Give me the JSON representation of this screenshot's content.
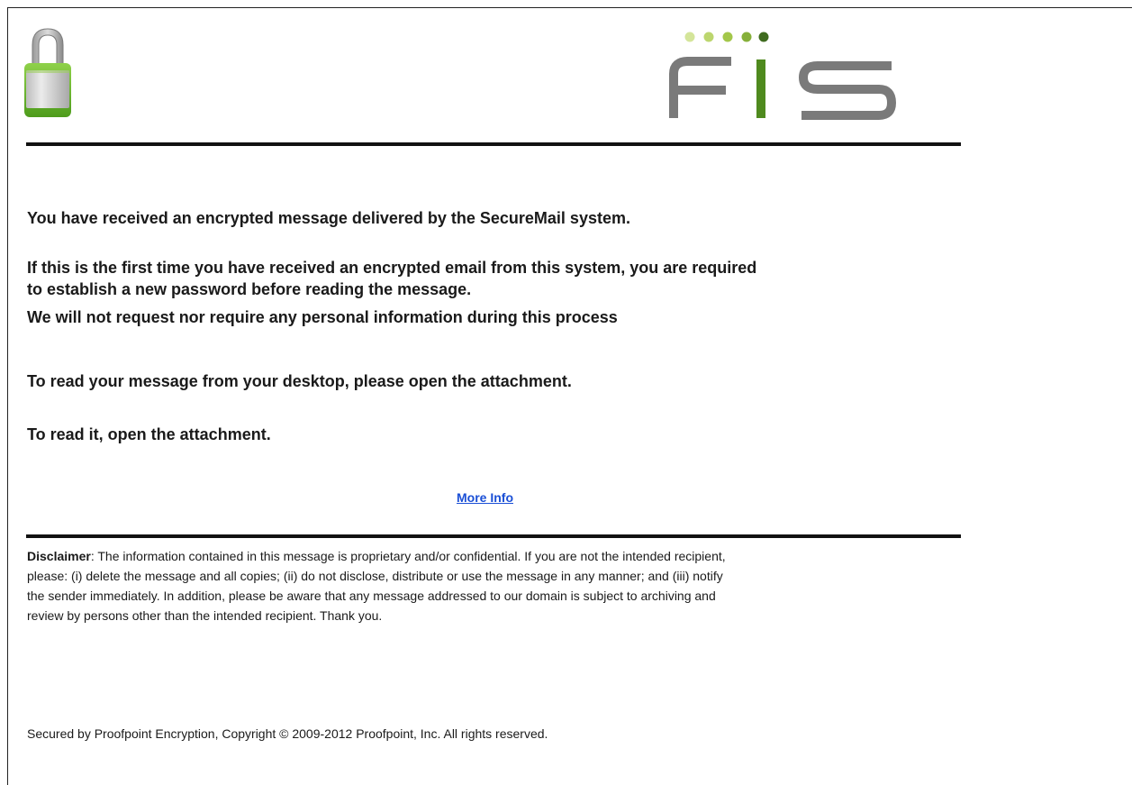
{
  "header": {
    "lock_logo_icon": "padlock-icon",
    "brand_logo": {
      "icon": "fis-logo",
      "text": "FIS",
      "dot_colors": [
        "#d4e59a",
        "#bcd66e",
        "#a3c74a",
        "#86b03a",
        "#3f6b1f"
      ],
      "letter_color": "#7a7a7a",
      "accent_color": "#4f8a1e"
    }
  },
  "message": {
    "line1": "You have received an encrypted message delivered by the SecureMail system.",
    "line2": "If this is the first time you have received an encrypted email from this system, you are required",
    "line3": "to establish a new password before reading the message.",
    "line4": "We will not request nor require any personal information during this process",
    "line5": "To read your message from your desktop, please open the attachment.",
    "line6": "To read it, open the attachment."
  },
  "more_info": {
    "label": "More Info"
  },
  "disclaimer": {
    "label": "Disclaimer",
    "line1": ": The information contained in this message is proprietary and/or confidential. If you are not the intended recipient,",
    "line2": "please: (i) delete the message and all copies; (ii) do not disclose, distribute or use the message in any manner; and (iii) notify",
    "line3": "the sender immediately. In addition, please be aware that any message addressed to our domain is subject to archiving and",
    "line4": "review by persons other than the intended recipient. Thank you."
  },
  "footer": {
    "text": "Secured by Proofpoint Encryption, Copyright © 2009-2012 Proofpoint, Inc. All rights reserved."
  },
  "colors": {
    "link": "#1a4fd6",
    "text": "#1a1a1a",
    "rule": "#111111"
  }
}
